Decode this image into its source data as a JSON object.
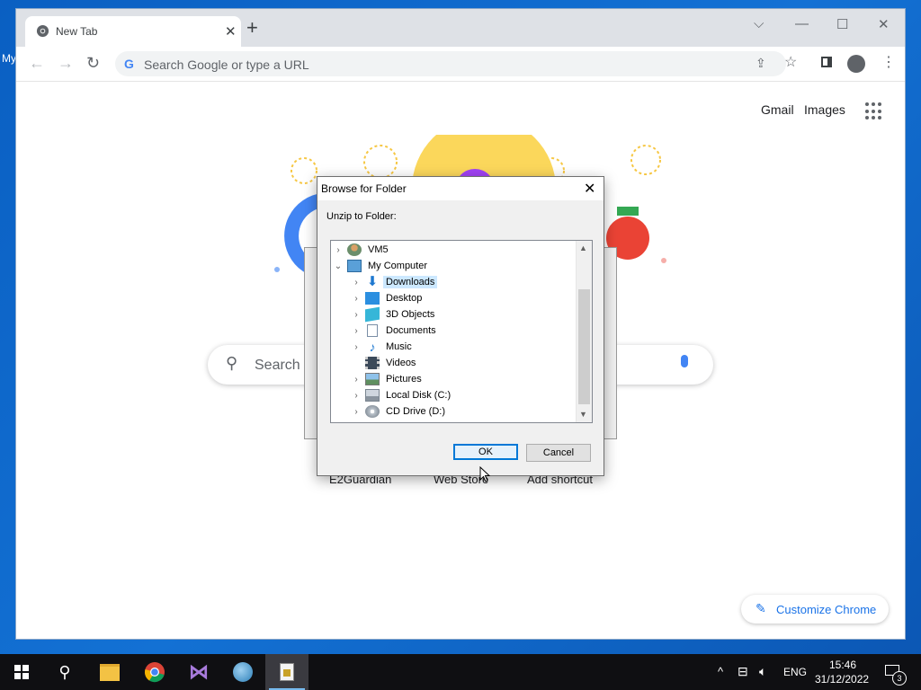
{
  "desktop": {
    "label": "My"
  },
  "browser": {
    "tab": {
      "title": "New Tab"
    },
    "omnibox": {
      "placeholder": "Search Google or type a URL"
    },
    "top_links": {
      "gmail": "Gmail",
      "images": "Images"
    },
    "searchbox": {
      "placeholder": "Search"
    },
    "shortcuts": [
      "E2Guardian",
      "Web Store",
      "Add shortcut"
    ],
    "customize": "Customize Chrome"
  },
  "dialog": {
    "title": "Browse for Folder",
    "description": "Unzip to Folder:",
    "tree": [
      {
        "label": "VM5",
        "icon": "user-icon",
        "expanded": false
      },
      {
        "label": "My Computer",
        "icon": "computer-icon",
        "expanded": true
      },
      {
        "label": "Downloads",
        "icon": "downloads-icon",
        "selected": true
      },
      {
        "label": "Desktop",
        "icon": "desktop-folder-icon"
      },
      {
        "label": "3D Objects",
        "icon": "3d-objects-icon"
      },
      {
        "label": "Documents",
        "icon": "documents-icon"
      },
      {
        "label": "Music",
        "icon": "music-icon"
      },
      {
        "label": "Videos",
        "icon": "videos-icon"
      },
      {
        "label": "Pictures",
        "icon": "pictures-icon"
      },
      {
        "label": "Local Disk (C:)",
        "icon": "local-disk-icon"
      },
      {
        "label": "CD Drive (D:)",
        "icon": "cd-drive-icon"
      }
    ],
    "ok_label": "OK",
    "cancel_label": "Cancel"
  },
  "taskbar": {
    "language": "ENG",
    "time": "15:46",
    "date": "31/12/2022",
    "notifications_count": "3"
  },
  "colors": {
    "desktop": "#0a5fc2",
    "taskbar": "#0f0f12",
    "accent": "#0078d7",
    "google_blue": "#4285f4",
    "customize_text": "#1a73e8",
    "tree_selection": "#cce8ff"
  }
}
